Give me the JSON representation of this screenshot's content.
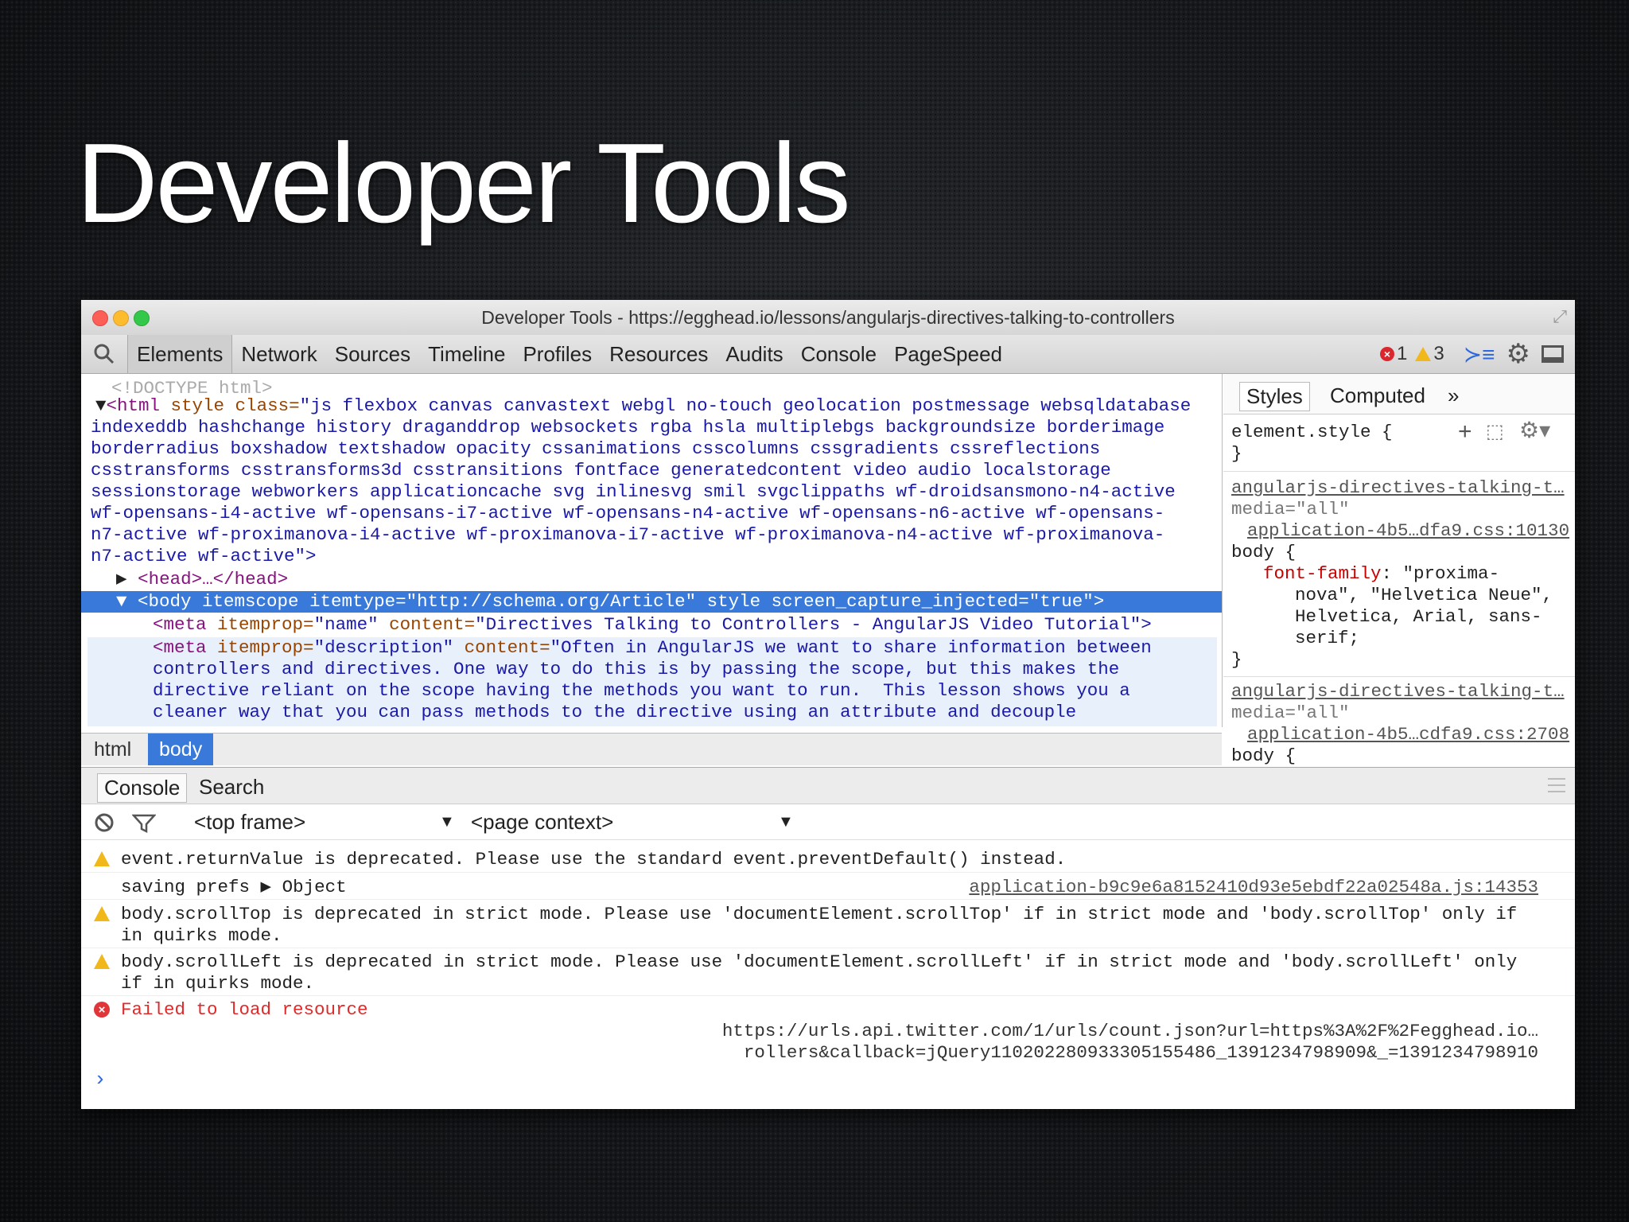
{
  "slide": {
    "title": "Developer Tools"
  },
  "window": {
    "title": "Developer Tools - https://egghead.io/lessons/angularjs-directives-talking-to-controllers"
  },
  "toolbar": {
    "tabs": [
      "Elements",
      "Network",
      "Sources",
      "Timeline",
      "Profiles",
      "Resources",
      "Audits",
      "Console",
      "PageSpeed"
    ],
    "active_tab": "Elements",
    "error_count": "1",
    "warning_count": "3"
  },
  "elements": {
    "doctype": "<!DOCTYPE html>",
    "html_open_lines": [
      "html class line 1",
      "indexeddb hashchange history draganddrop websockets rgba hsla multiplebgs backgroundsize borderimage",
      "borderradius boxshadow textshadow opacity cssanimations csscolumns cssgradients cssreflections",
      "csstransforms csstransforms3d csstransitions fontface generatedcontent video audio localstorage",
      "sessionstorage webworkers applicationcache svg inlinesvg smil svgclippaths wf-droidsansmono-n4-active",
      "wf-opensans-i4-active wf-opensans-i7-active wf-opensans-n4-active wf-opensans-n6-active wf-opensans-",
      "n7-active wf-proximanova-i4-active wf-proximanova-i7-active wf-proximanova-n4-active wf-proximanova-",
      "n7-active wf-active\">"
    ],
    "html_tag_prefix": "<html",
    "html_attr": "style class=",
    "html_val_start": "\"js flexbox canvas canvastext webgl no-touch geolocation postmessage websqldatabase",
    "head_collapsed": "<head>…</head>",
    "body_line": "<body itemscope itemtype=\"http://schema.org/Article\" style screen_capture_injected=\"true\">",
    "meta_name": {
      "tag": "<meta",
      "attr1": "itemprop=",
      "val1": "\"name\"",
      "attr2": "content=",
      "val2": "\"Directives Talking to Controllers - AngularJS Video Tutorial\">"
    },
    "meta_desc": {
      "tag": "<meta",
      "attr1": "itemprop=",
      "val1": "\"description\"",
      "attr2": "content=",
      "val2_lines": [
        "\"Often in AngularJS we want to share information between",
        "controllers and directives. One way to do this is by passing the scope, but this makes the",
        "directive reliant on the scope having the methods you want to run.  This lesson shows you a",
        "cleaner way that you can pass methods to the directive using an attribute and decouple"
      ]
    },
    "breadcrumbs": [
      "html",
      "body"
    ]
  },
  "styles": {
    "tabs": [
      "Styles",
      "Computed"
    ],
    "more": "»",
    "element_style": "element.style {",
    "close_brace": "}",
    "rule1": {
      "source": "angularjs-directives-talking-t…",
      "media": "media=\"all\"",
      "file": "application-4b5…dfa9.css:10130",
      "selector": "body {",
      "prop": "font-family",
      "value_lines": [
        "\"proxima-",
        "nova\", \"Helvetica Neue\",",
        "Helvetica, Arial, sans-",
        "serif;"
      ]
    },
    "rule2": {
      "source": "angularjs-directives-talking-t…",
      "media": "media=\"all\"",
      "file": "application-4b5…cdfa9.css:2708",
      "selector": "body {"
    }
  },
  "console": {
    "tabs": [
      "Console",
      "Search"
    ],
    "frame": "<top frame>",
    "context": "<page context>",
    "messages": [
      {
        "level": "warning",
        "lines": [
          "event.returnValue is deprecated. Please use the standard event.preventDefault() instead."
        ]
      },
      {
        "level": "log",
        "lines": [
          "saving prefs ▶ Object"
        ],
        "source": "application-b9c9e6a8152410d93e5ebdf22a02548a.js:14353"
      },
      {
        "level": "warning",
        "lines": [
          "body.scrollTop is deprecated in strict mode. Please use 'documentElement.scrollTop' if in strict mode and 'body.scrollTop' only if",
          "in quirks mode."
        ]
      },
      {
        "level": "warning",
        "lines": [
          "body.scrollLeft is deprecated in strict mode. Please use 'documentElement.scrollLeft' if in strict mode and 'body.scrollLeft' only",
          "if in quirks mode."
        ]
      },
      {
        "level": "error",
        "lines": [
          "Failed to load resource"
        ],
        "url_lines": [
          "https://urls.api.twitter.com/1/urls/count.json?url=https%3A%2F%2Fegghead.io…",
          "rollers&callback=jQuery110202280933305155486_1391234798909&_=1391234798910"
        ]
      }
    ],
    "prompt": "›"
  }
}
